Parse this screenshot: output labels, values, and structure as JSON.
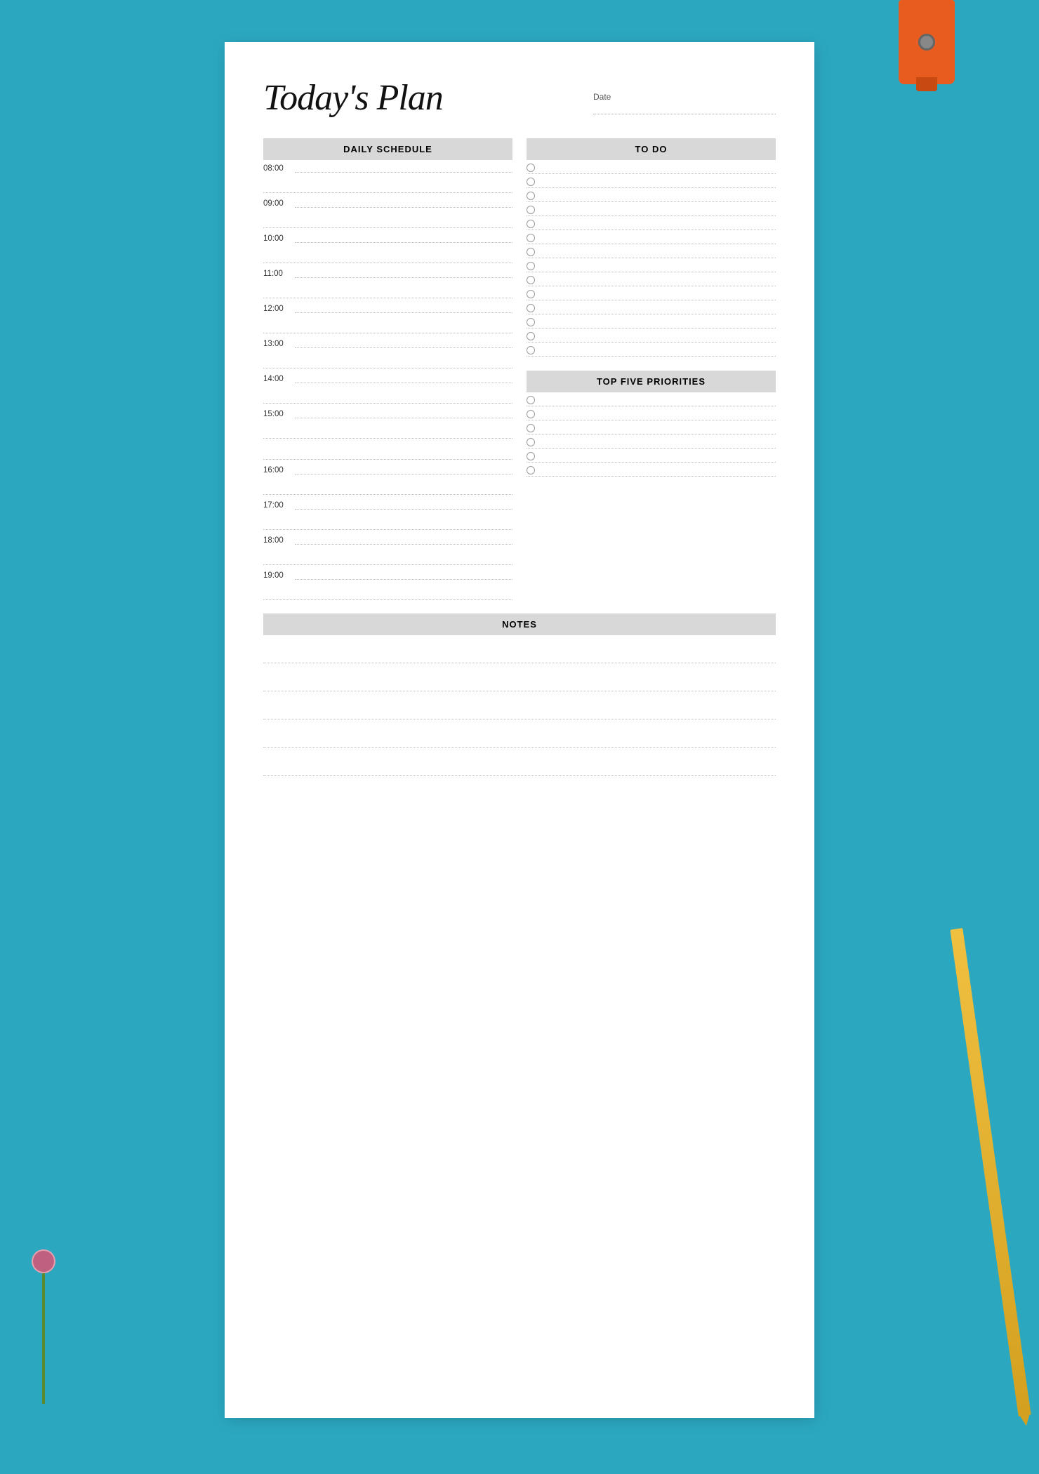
{
  "page": {
    "title": "Today's Plan",
    "date_label": "Date",
    "background_color": "#2ba8c0",
    "paper_color": "#ffffff"
  },
  "daily_schedule": {
    "header": "DAILY SCHEDULE",
    "times": [
      "08:00",
      "09:00",
      "10:00",
      "11:00",
      "12:00",
      "13:00",
      "14:00",
      "15:00",
      "16:00",
      "17:00",
      "18:00",
      "19:00"
    ]
  },
  "todo": {
    "header": "TO DO",
    "items": 14
  },
  "top_five": {
    "header": "TOP FIVE PRIORITIES",
    "items": 6
  },
  "notes": {
    "header": "NOTES",
    "lines": 5
  }
}
